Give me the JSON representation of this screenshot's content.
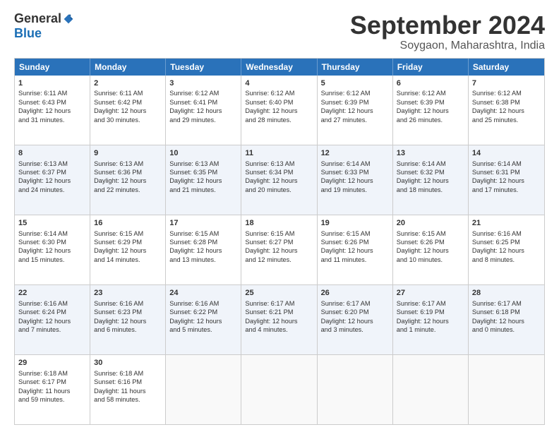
{
  "logo": {
    "general": "General",
    "blue": "Blue"
  },
  "title": "September 2024",
  "location": "Soygaon, Maharashtra, India",
  "header_days": [
    "Sunday",
    "Monday",
    "Tuesday",
    "Wednesday",
    "Thursday",
    "Friday",
    "Saturday"
  ],
  "rows": [
    [
      {
        "day": "1",
        "lines": [
          "Sunrise: 6:11 AM",
          "Sunset: 6:43 PM",
          "Daylight: 12 hours",
          "and 31 minutes."
        ]
      },
      {
        "day": "2",
        "lines": [
          "Sunrise: 6:11 AM",
          "Sunset: 6:42 PM",
          "Daylight: 12 hours",
          "and 30 minutes."
        ]
      },
      {
        "day": "3",
        "lines": [
          "Sunrise: 6:12 AM",
          "Sunset: 6:41 PM",
          "Daylight: 12 hours",
          "and 29 minutes."
        ]
      },
      {
        "day": "4",
        "lines": [
          "Sunrise: 6:12 AM",
          "Sunset: 6:40 PM",
          "Daylight: 12 hours",
          "and 28 minutes."
        ]
      },
      {
        "day": "5",
        "lines": [
          "Sunrise: 6:12 AM",
          "Sunset: 6:39 PM",
          "Daylight: 12 hours",
          "and 27 minutes."
        ]
      },
      {
        "day": "6",
        "lines": [
          "Sunrise: 6:12 AM",
          "Sunset: 6:39 PM",
          "Daylight: 12 hours",
          "and 26 minutes."
        ]
      },
      {
        "day": "7",
        "lines": [
          "Sunrise: 6:12 AM",
          "Sunset: 6:38 PM",
          "Daylight: 12 hours",
          "and 25 minutes."
        ]
      }
    ],
    [
      {
        "day": "8",
        "lines": [
          "Sunrise: 6:13 AM",
          "Sunset: 6:37 PM",
          "Daylight: 12 hours",
          "and 24 minutes."
        ]
      },
      {
        "day": "9",
        "lines": [
          "Sunrise: 6:13 AM",
          "Sunset: 6:36 PM",
          "Daylight: 12 hours",
          "and 22 minutes."
        ]
      },
      {
        "day": "10",
        "lines": [
          "Sunrise: 6:13 AM",
          "Sunset: 6:35 PM",
          "Daylight: 12 hours",
          "and 21 minutes."
        ]
      },
      {
        "day": "11",
        "lines": [
          "Sunrise: 6:13 AM",
          "Sunset: 6:34 PM",
          "Daylight: 12 hours",
          "and 20 minutes."
        ]
      },
      {
        "day": "12",
        "lines": [
          "Sunrise: 6:14 AM",
          "Sunset: 6:33 PM",
          "Daylight: 12 hours",
          "and 19 minutes."
        ]
      },
      {
        "day": "13",
        "lines": [
          "Sunrise: 6:14 AM",
          "Sunset: 6:32 PM",
          "Daylight: 12 hours",
          "and 18 minutes."
        ]
      },
      {
        "day": "14",
        "lines": [
          "Sunrise: 6:14 AM",
          "Sunset: 6:31 PM",
          "Daylight: 12 hours",
          "and 17 minutes."
        ]
      }
    ],
    [
      {
        "day": "15",
        "lines": [
          "Sunrise: 6:14 AM",
          "Sunset: 6:30 PM",
          "Daylight: 12 hours",
          "and 15 minutes."
        ]
      },
      {
        "day": "16",
        "lines": [
          "Sunrise: 6:15 AM",
          "Sunset: 6:29 PM",
          "Daylight: 12 hours",
          "and 14 minutes."
        ]
      },
      {
        "day": "17",
        "lines": [
          "Sunrise: 6:15 AM",
          "Sunset: 6:28 PM",
          "Daylight: 12 hours",
          "and 13 minutes."
        ]
      },
      {
        "day": "18",
        "lines": [
          "Sunrise: 6:15 AM",
          "Sunset: 6:27 PM",
          "Daylight: 12 hours",
          "and 12 minutes."
        ]
      },
      {
        "day": "19",
        "lines": [
          "Sunrise: 6:15 AM",
          "Sunset: 6:26 PM",
          "Daylight: 12 hours",
          "and 11 minutes."
        ]
      },
      {
        "day": "20",
        "lines": [
          "Sunrise: 6:15 AM",
          "Sunset: 6:26 PM",
          "Daylight: 12 hours",
          "and 10 minutes."
        ]
      },
      {
        "day": "21",
        "lines": [
          "Sunrise: 6:16 AM",
          "Sunset: 6:25 PM",
          "Daylight: 12 hours",
          "and 8 minutes."
        ]
      }
    ],
    [
      {
        "day": "22",
        "lines": [
          "Sunrise: 6:16 AM",
          "Sunset: 6:24 PM",
          "Daylight: 12 hours",
          "and 7 minutes."
        ]
      },
      {
        "day": "23",
        "lines": [
          "Sunrise: 6:16 AM",
          "Sunset: 6:23 PM",
          "Daylight: 12 hours",
          "and 6 minutes."
        ]
      },
      {
        "day": "24",
        "lines": [
          "Sunrise: 6:16 AM",
          "Sunset: 6:22 PM",
          "Daylight: 12 hours",
          "and 5 minutes."
        ]
      },
      {
        "day": "25",
        "lines": [
          "Sunrise: 6:17 AM",
          "Sunset: 6:21 PM",
          "Daylight: 12 hours",
          "and 4 minutes."
        ]
      },
      {
        "day": "26",
        "lines": [
          "Sunrise: 6:17 AM",
          "Sunset: 6:20 PM",
          "Daylight: 12 hours",
          "and 3 minutes."
        ]
      },
      {
        "day": "27",
        "lines": [
          "Sunrise: 6:17 AM",
          "Sunset: 6:19 PM",
          "Daylight: 12 hours",
          "and 1 minute."
        ]
      },
      {
        "day": "28",
        "lines": [
          "Sunrise: 6:17 AM",
          "Sunset: 6:18 PM",
          "Daylight: 12 hours",
          "and 0 minutes."
        ]
      }
    ],
    [
      {
        "day": "29",
        "lines": [
          "Sunrise: 6:18 AM",
          "Sunset: 6:17 PM",
          "Daylight: 11 hours",
          "and 59 minutes."
        ]
      },
      {
        "day": "30",
        "lines": [
          "Sunrise: 6:18 AM",
          "Sunset: 6:16 PM",
          "Daylight: 11 hours",
          "and 58 minutes."
        ]
      },
      {
        "day": "",
        "lines": []
      },
      {
        "day": "",
        "lines": []
      },
      {
        "day": "",
        "lines": []
      },
      {
        "day": "",
        "lines": []
      },
      {
        "day": "",
        "lines": []
      }
    ]
  ]
}
